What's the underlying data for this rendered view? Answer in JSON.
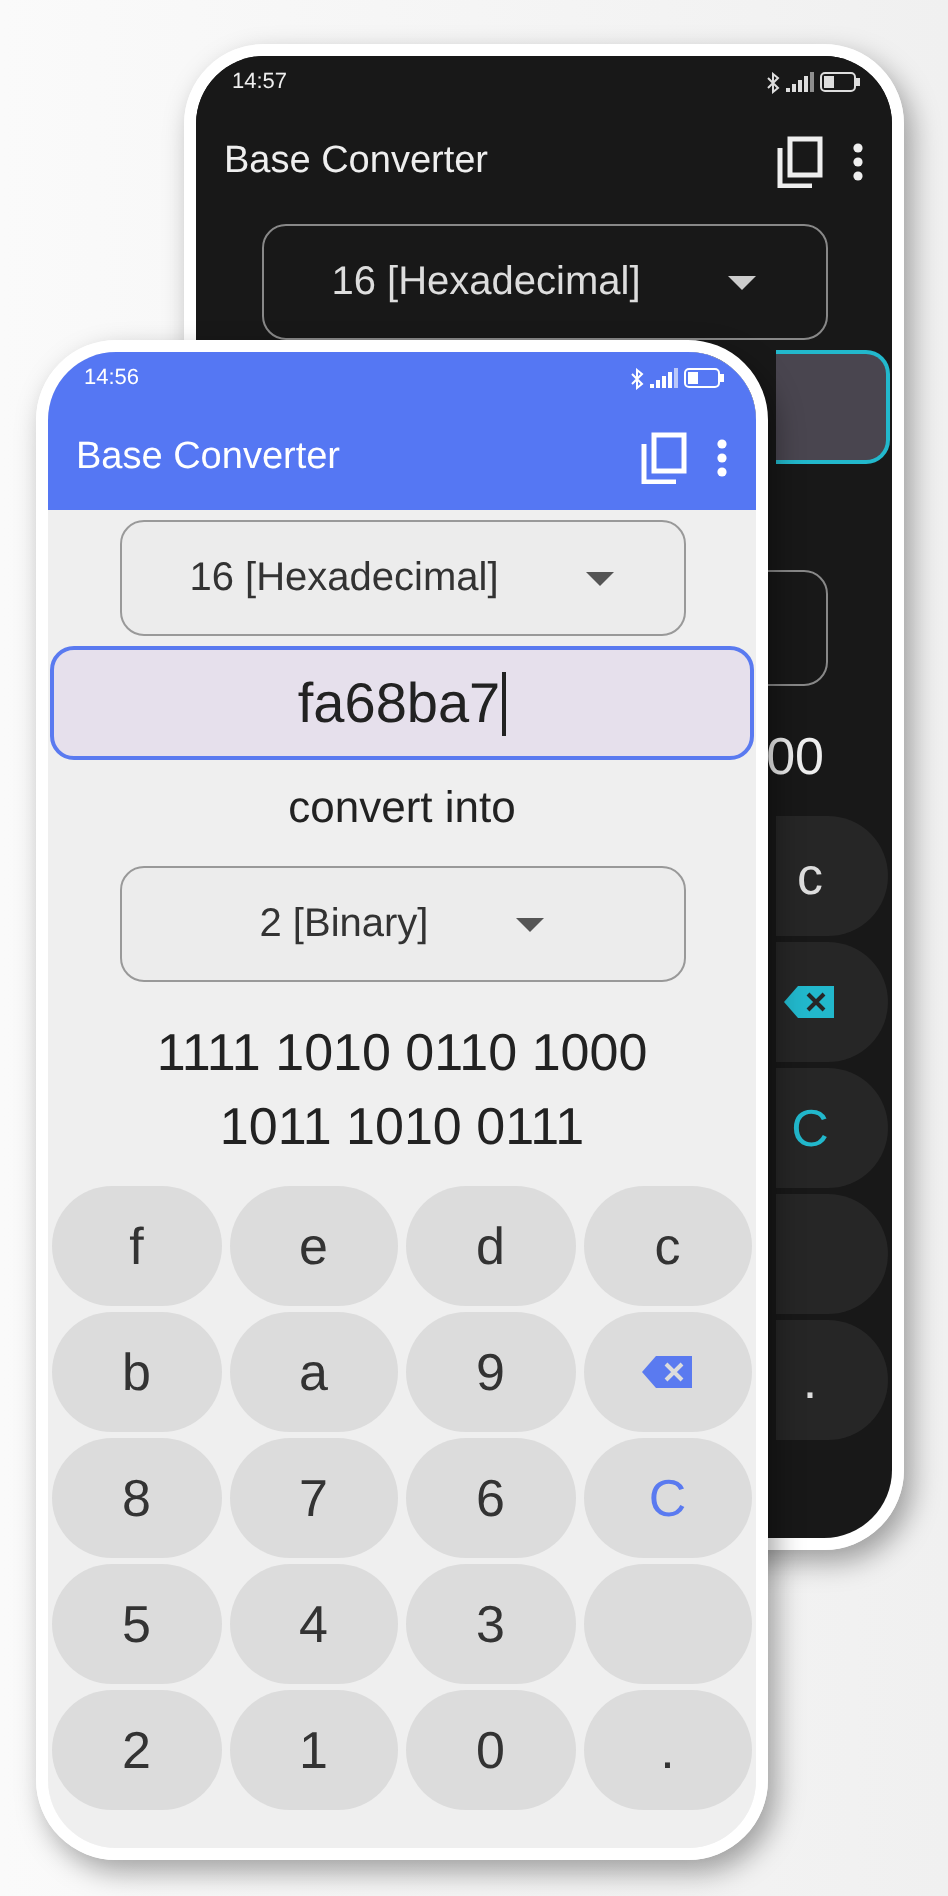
{
  "phones": [
    {
      "kind": "dark",
      "status_bar": {
        "time": "14:57"
      },
      "app_bar": {
        "title": "Base Converter"
      },
      "from_base": "16 [Hexadecimal]",
      "result_lines": [
        "00"
      ],
      "keys": [
        {
          "label": "c",
          "kind": "digit"
        },
        {
          "kind": "backspace"
        },
        {
          "label": "C",
          "kind": "clear"
        },
        {
          "kind": "blank"
        },
        {
          "label": ".",
          "kind": "digit"
        }
      ]
    },
    {
      "kind": "light",
      "status_bar": {
        "time": "14:56"
      },
      "app_bar": {
        "title": "Base Converter"
      },
      "from_base": "16 [Hexadecimal]",
      "input": {
        "value": "fa68ba7"
      },
      "convert_label": "convert into",
      "to_base": "2 [Binary]",
      "result_lines": [
        "1111 1010 0110 1000",
        "1011 1010 0111"
      ],
      "keys": [
        {
          "label": "f",
          "kind": "digit"
        },
        {
          "label": "e",
          "kind": "digit"
        },
        {
          "label": "d",
          "kind": "digit"
        },
        {
          "label": "c",
          "kind": "digit"
        },
        {
          "label": "b",
          "kind": "digit"
        },
        {
          "label": "a",
          "kind": "digit"
        },
        {
          "label": "9",
          "kind": "digit"
        },
        {
          "kind": "backspace"
        },
        {
          "label": "8",
          "kind": "digit"
        },
        {
          "label": "7",
          "kind": "digit"
        },
        {
          "label": "6",
          "kind": "digit"
        },
        {
          "label": "C",
          "kind": "clear"
        },
        {
          "label": "5",
          "kind": "digit"
        },
        {
          "label": "4",
          "kind": "digit"
        },
        {
          "label": "3",
          "kind": "digit"
        },
        {
          "kind": "blank"
        },
        {
          "label": "2",
          "kind": "digit"
        },
        {
          "label": "1",
          "kind": "digit"
        },
        {
          "label": "0",
          "kind": "digit"
        },
        {
          "label": ".",
          "kind": "digit"
        }
      ]
    }
  ]
}
